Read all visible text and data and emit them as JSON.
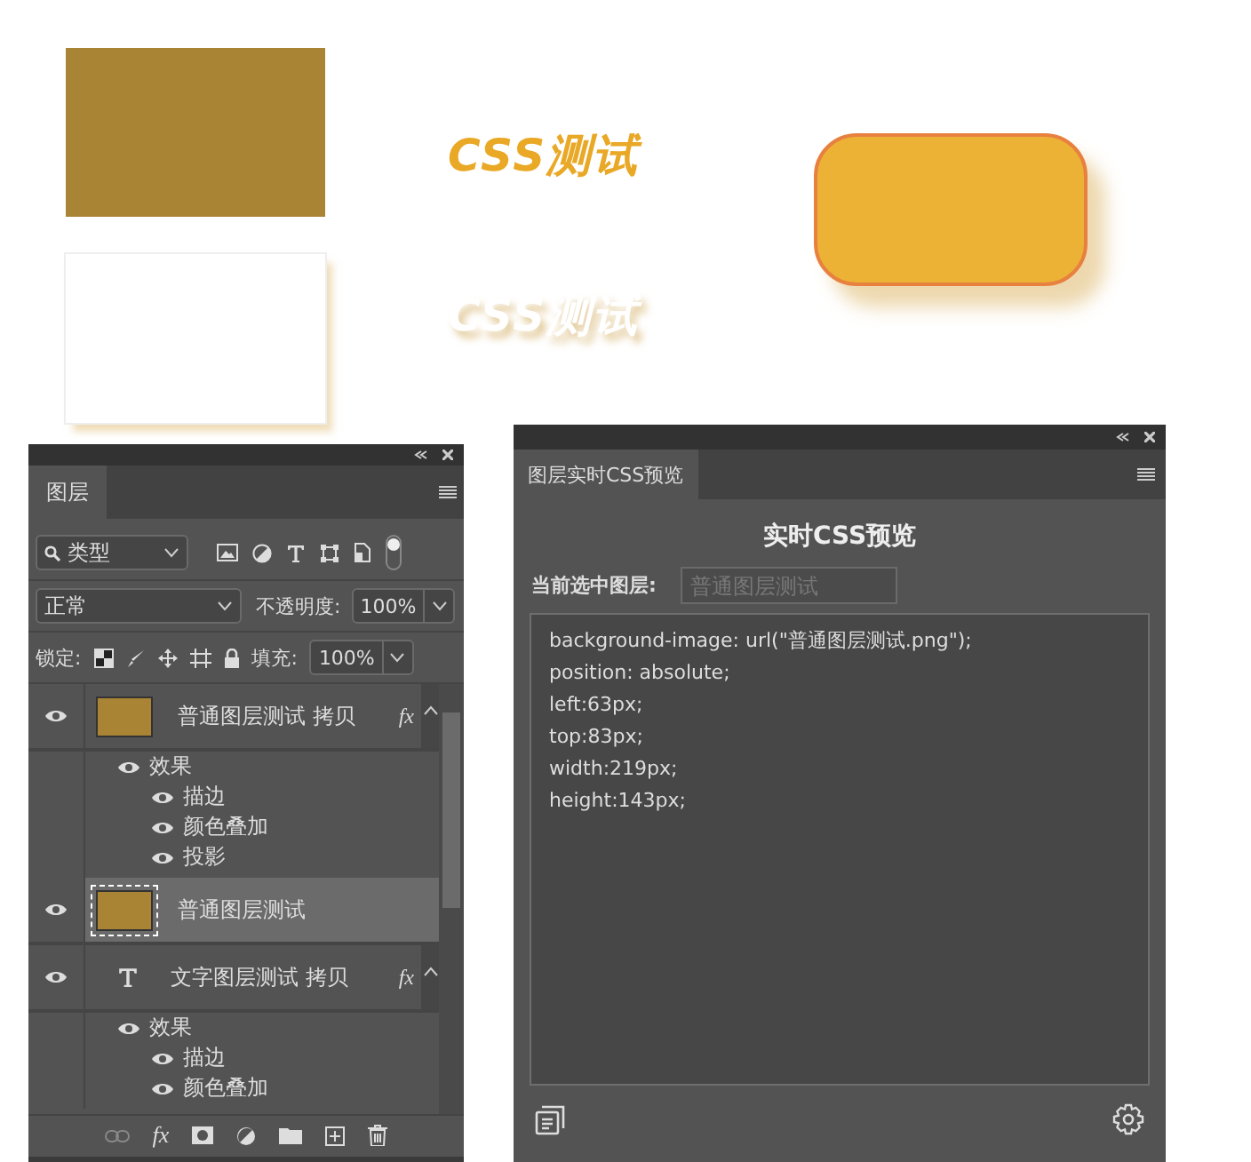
{
  "canvas": {
    "items": [
      {
        "kind": "rect",
        "color": "#a98434",
        "shadow": false
      },
      {
        "kind": "rect",
        "color": "#ffffff",
        "shadow": true
      },
      {
        "kind": "text",
        "text": "CSS测试",
        "color": "#e9a825",
        "shadow": false
      },
      {
        "kind": "text",
        "text": "CSS测试",
        "color": "#ffffff",
        "shadow": true
      },
      {
        "kind": "rounded",
        "color": "#ecb236",
        "shadow": true
      }
    ]
  },
  "layers_panel": {
    "tab": "图层",
    "filter": {
      "value": "类型",
      "toggle_on": true
    },
    "blend_mode": "正常",
    "opacity_label": "不透明度:",
    "opacity": "100%",
    "lock_label": "锁定:",
    "fill_label": "填充:",
    "fill": "100%",
    "layers": [
      {
        "kind": "image",
        "name": "普通图层测试 拷贝",
        "visible": true,
        "selected": false,
        "fx": "fx",
        "expanded": true,
        "children": [
          {
            "name": "效果",
            "visible": true,
            "children": [
              {
                "name": "描边",
                "visible": true
              },
              {
                "name": "颜色叠加",
                "visible": true
              },
              {
                "name": "投影",
                "visible": true
              }
            ]
          }
        ]
      },
      {
        "kind": "image",
        "name": "普通图层测试",
        "visible": true,
        "selected": true
      },
      {
        "kind": "text",
        "name": "文字图层测试 拷贝",
        "visible": true,
        "selected": false,
        "fx": "fx",
        "expanded": true,
        "children": [
          {
            "name": "效果",
            "visible": true,
            "children": [
              {
                "name": "描边",
                "visible": true
              },
              {
                "name": "颜色叠加",
                "visible": true
              }
            ]
          }
        ]
      }
    ],
    "style_button": "fx"
  },
  "css_panel": {
    "tab": "图层实时CSS预览",
    "heading": "实时CSS预览",
    "current_label": "当前选中图层:",
    "current_layer": {
      "placeholder": "普通图层测试"
    },
    "code": [
      "background-image: url(\"普通图层测试.png\");",
      "position: absolute;",
      "left:63px;",
      "top:83px;",
      "width:219px;",
      "height:143px;"
    ]
  }
}
